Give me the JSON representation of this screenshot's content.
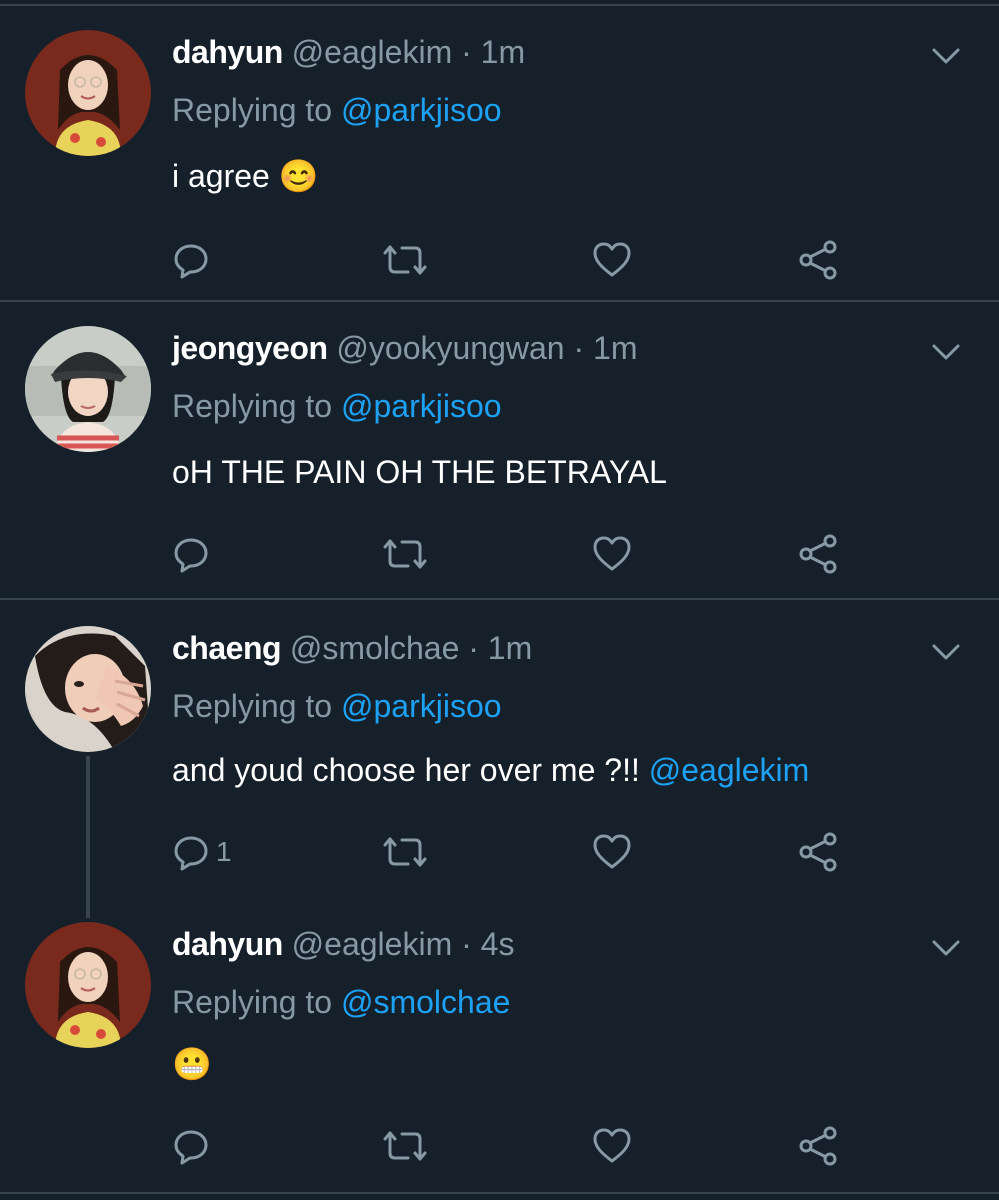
{
  "tweets": [
    {
      "name": "dahyun",
      "handle": "@eaglekim",
      "dot": "·",
      "time": "1m",
      "replying_prefix": "Replying to",
      "replying_to": "@parkjisoo",
      "text": "i agree",
      "emoji": "😊",
      "reply_count": ""
    },
    {
      "name": "jeongyeon",
      "handle": "@yookyungwan",
      "dot": "·",
      "time": "1m",
      "replying_prefix": "Replying to",
      "replying_to": "@parkjisoo",
      "text": "oH THE PAIN OH THE BETRAYAL",
      "reply_count": ""
    },
    {
      "name": "chaeng",
      "handle": "@smolchae",
      "dot": "·",
      "time": "1m",
      "replying_prefix": "Replying to",
      "replying_to": "@parkjisoo",
      "text": "and youd choose her over me ?!!",
      "mention": "@eaglekim",
      "reply_count": "1"
    },
    {
      "name": "dahyun",
      "handle": "@eaglekim",
      "dot": "·",
      "time": "4s",
      "replying_prefix": "Replying to",
      "replying_to": "@smolchae",
      "emoji": "😬",
      "reply_count": ""
    }
  ],
  "colors": {
    "background": "#15202b",
    "divider": "#38444d",
    "muted": "#8899a6",
    "link": "#1da1f2"
  },
  "icons": [
    "reply-icon",
    "retweet-icon",
    "like-icon",
    "share-icon",
    "chevron-down-icon"
  ]
}
